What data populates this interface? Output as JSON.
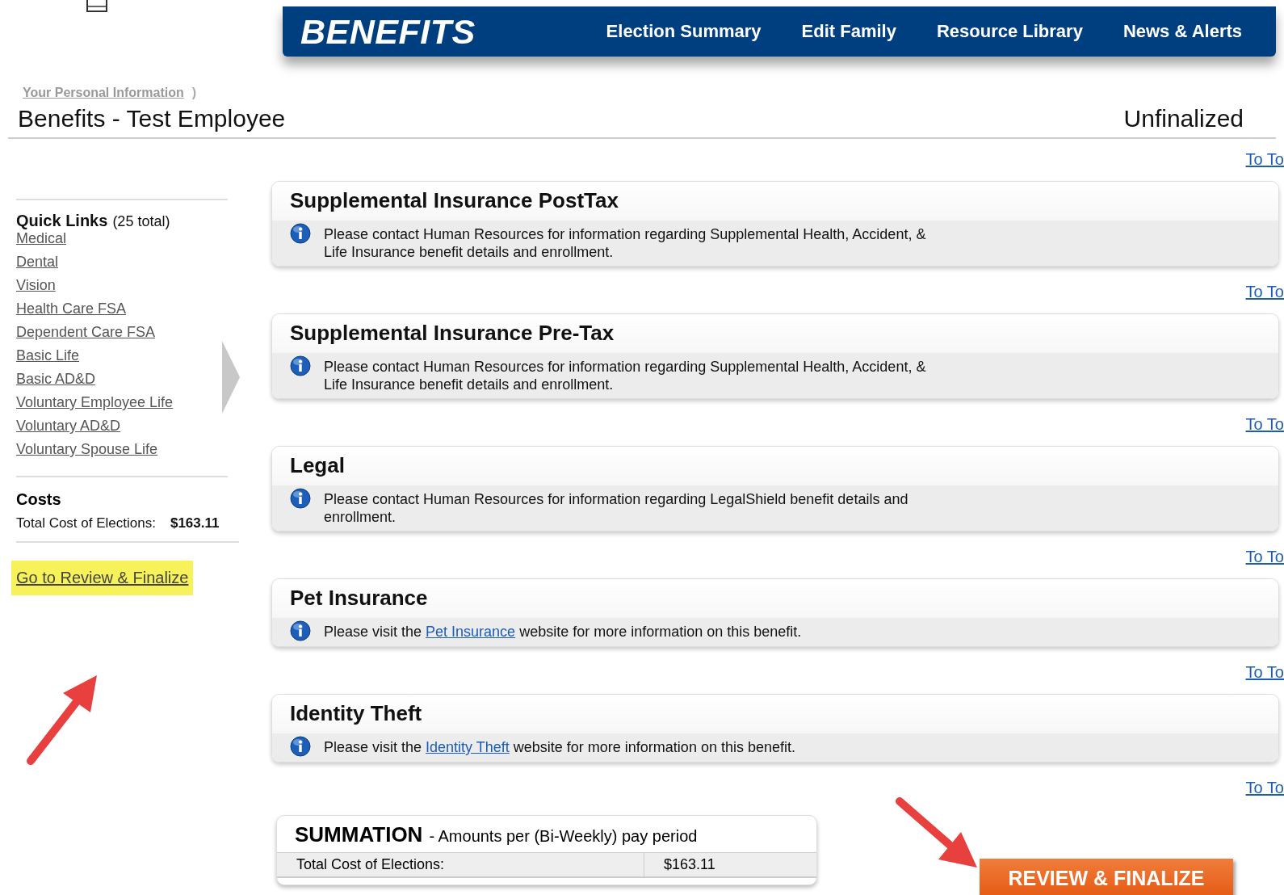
{
  "header": {
    "brand": "BENEFITS",
    "nav": [
      {
        "label": "Election Summary"
      },
      {
        "label": "Edit Family"
      },
      {
        "label": "Resource Library"
      },
      {
        "label": "News & Alerts"
      }
    ]
  },
  "breadcrumb": {
    "link": "Your Personal Information",
    "separator": ")"
  },
  "page": {
    "title": "Benefits - Test Employee",
    "status": "Unfinalized"
  },
  "sidebar": {
    "quick_links_title": "Quick Links",
    "quick_links_count": "(25 total)",
    "links": [
      {
        "label": "Medical"
      },
      {
        "label": "Dental"
      },
      {
        "label": "Vision"
      },
      {
        "label": "Health Care FSA"
      },
      {
        "label": "Dependent Care FSA"
      },
      {
        "label": "Basic Life"
      },
      {
        "label": "Basic AD&D"
      },
      {
        "label": "Voluntary Employee Life"
      },
      {
        "label": "Voluntary AD&D"
      },
      {
        "label": "Voluntary Spouse Life"
      }
    ],
    "costs_title": "Costs",
    "cost_label": "Total Cost of Elections:",
    "cost_value": "$163.11",
    "review_link": {
      "label": "Go to Review & Finalize",
      "highlighted": true
    }
  },
  "sections": [
    {
      "to_top": "To To",
      "title": "Supplemental Insurance PostTax",
      "message": {
        "kind": "text",
        "text": "Please contact Human Resources for information regarding Supplemental Health, Accident, & Life Insurance benefit details and enrollment."
      }
    },
    {
      "to_top": "To To",
      "title": "Supplemental Insurance Pre-Tax",
      "message": {
        "kind": "text",
        "text": "Please contact Human Resources for information regarding Supplemental Health, Accident, & Life Insurance benefit details and enrollment."
      }
    },
    {
      "to_top": "To To",
      "title": "Legal",
      "message": {
        "kind": "text",
        "text": "Please contact Human Resources for information regarding LegalShield benefit details and enrollment."
      }
    },
    {
      "to_top": "To To",
      "title": "Pet Insurance",
      "message": {
        "kind": "link",
        "before": "Please visit the",
        "link": "Pet Insurance",
        "after": "website for more information on this benefit."
      }
    },
    {
      "to_top": "To To",
      "title": "Identity Theft",
      "message": {
        "kind": "link",
        "before": "Please visit the",
        "link": "Identity Theft",
        "after": "website for more information on this benefit."
      }
    }
  ],
  "final_to_top": "To To",
  "summation": {
    "title": "SUMMATION",
    "subtitle": "- Amounts per (Bi-Weekly) pay period",
    "label": "Total Cost of Elections:",
    "value": "$163.11"
  },
  "review_button": "REVIEW & FINALIZE"
}
